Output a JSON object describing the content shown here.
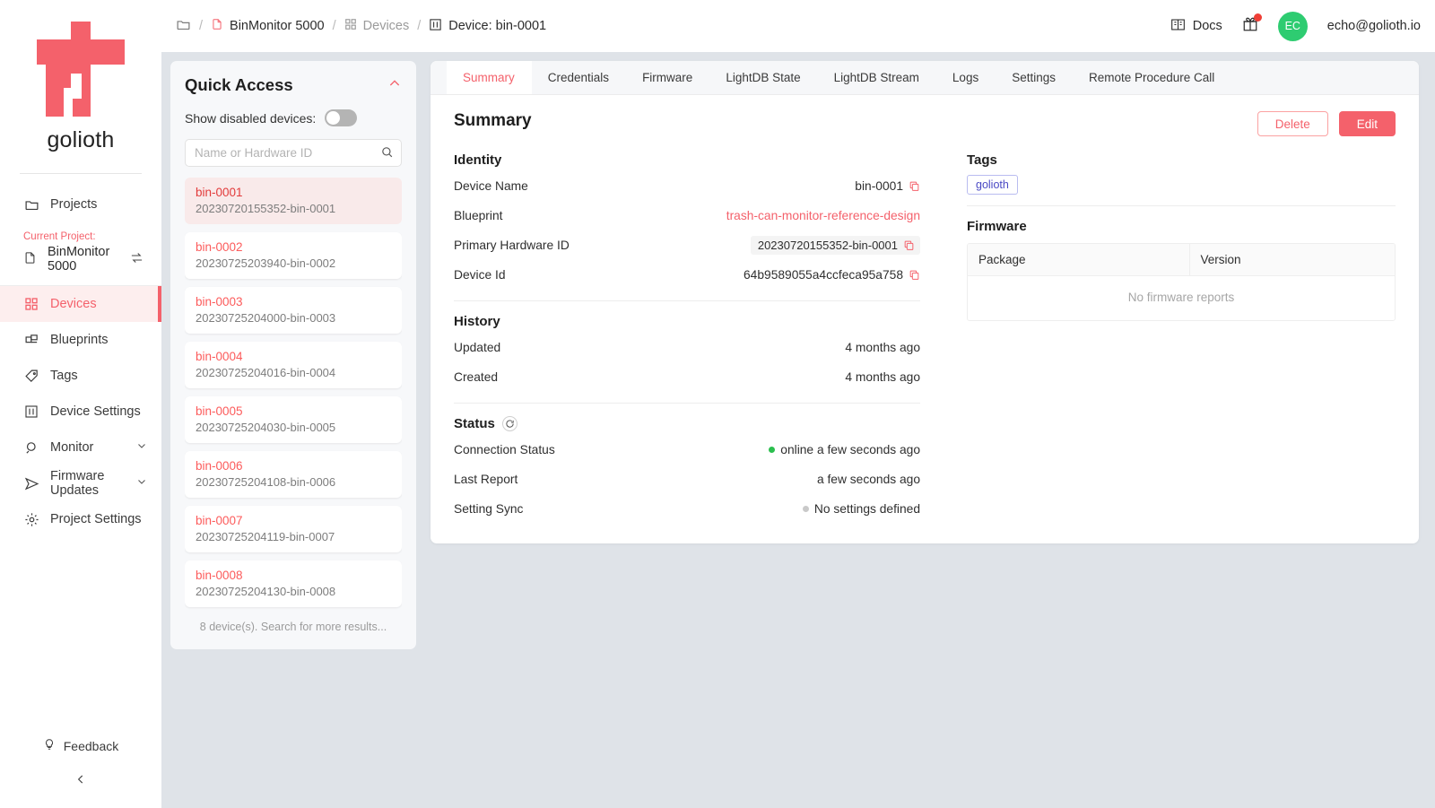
{
  "brand": {
    "name": "golioth",
    "accent": "#f4616b"
  },
  "breadcrumb": {
    "project": "BinMonitor 5000",
    "devices": "Devices",
    "device": "Device: bin-0001"
  },
  "topbar": {
    "docs_label": "Docs",
    "avatar_initials": "EC",
    "email": "echo@golioth.io"
  },
  "sidebar": {
    "projects_label": "Projects",
    "current_project_label": "Current Project:",
    "current_project": "BinMonitor 5000",
    "items": [
      {
        "label": "Devices"
      },
      {
        "label": "Blueprints"
      },
      {
        "label": "Tags"
      },
      {
        "label": "Device Settings"
      },
      {
        "label": "Monitor"
      },
      {
        "label": "Firmware Updates"
      },
      {
        "label": "Project Settings"
      }
    ],
    "feedback_label": "Feedback"
  },
  "quick_access": {
    "title": "Quick Access",
    "toggle_label": "Show disabled devices:",
    "toggle_state": "off",
    "search_placeholder": "Name or Hardware ID",
    "search_value": "",
    "footer": "8 device(s). Search for more results...",
    "devices": [
      {
        "name": "bin-0001",
        "hardware_id": "20230720155352-bin-0001",
        "selected": true
      },
      {
        "name": "bin-0002",
        "hardware_id": "20230725203940-bin-0002",
        "selected": false
      },
      {
        "name": "bin-0003",
        "hardware_id": "20230725204000-bin-0003",
        "selected": false
      },
      {
        "name": "bin-0004",
        "hardware_id": "20230725204016-bin-0004",
        "selected": false
      },
      {
        "name": "bin-0005",
        "hardware_id": "20230725204030-bin-0005",
        "selected": false
      },
      {
        "name": "bin-0006",
        "hardware_id": "20230725204108-bin-0006",
        "selected": false
      },
      {
        "name": "bin-0007",
        "hardware_id": "20230725204119-bin-0007",
        "selected": false
      },
      {
        "name": "bin-0008",
        "hardware_id": "20230725204130-bin-0008",
        "selected": false
      }
    ]
  },
  "tabs": [
    {
      "label": "Summary",
      "active": true
    },
    {
      "label": "Credentials",
      "active": false
    },
    {
      "label": "Firmware",
      "active": false
    },
    {
      "label": "LightDB State",
      "active": false
    },
    {
      "label": "LightDB Stream",
      "active": false
    },
    {
      "label": "Logs",
      "active": false
    },
    {
      "label": "Settings",
      "active": false
    },
    {
      "label": "Remote Procedure Call",
      "active": false
    }
  ],
  "summary": {
    "title": "Summary",
    "delete_label": "Delete",
    "edit_label": "Edit",
    "identity": {
      "heading": "Identity",
      "device_name_label": "Device Name",
      "device_name_value": "bin-0001",
      "blueprint_label": "Blueprint",
      "blueprint_value": "trash-can-monitor-reference-design",
      "hardware_id_label": "Primary Hardware ID",
      "hardware_id_value": "20230720155352-bin-0001",
      "device_id_label": "Device Id",
      "device_id_value": "64b9589055a4ccfeca95a758"
    },
    "history": {
      "heading": "History",
      "updated_label": "Updated",
      "updated_value": "4 months ago",
      "created_label": "Created",
      "created_value": "4 months ago"
    },
    "status": {
      "heading": "Status",
      "connection_label": "Connection Status",
      "connection_value": "online a few seconds ago",
      "last_report_label": "Last Report",
      "last_report_value": "a few seconds ago",
      "setting_sync_label": "Setting Sync",
      "setting_sync_value": "No settings defined"
    },
    "tags": {
      "heading": "Tags",
      "items": [
        "golioth"
      ]
    },
    "firmware": {
      "heading": "Firmware",
      "columns": [
        "Package",
        "Version"
      ],
      "empty_text": "No firmware reports"
    }
  }
}
